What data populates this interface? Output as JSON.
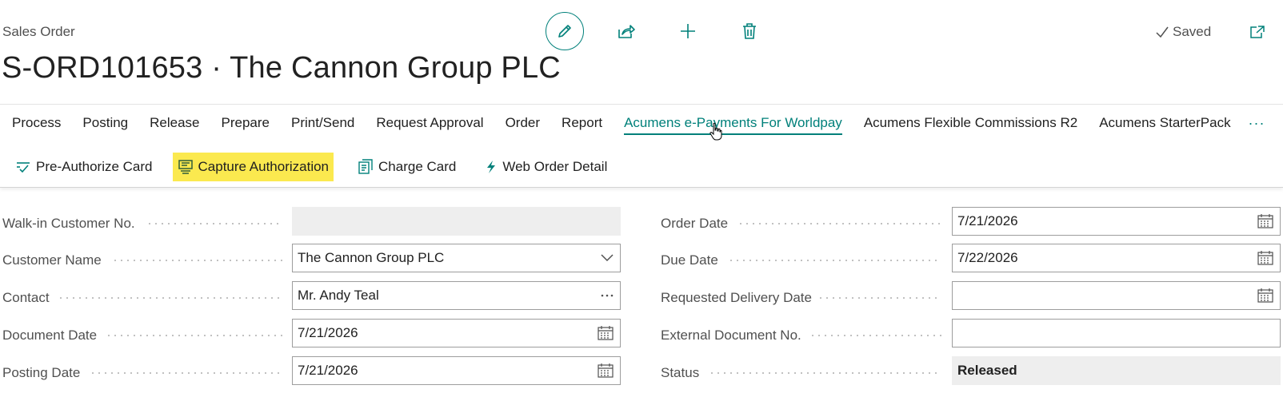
{
  "header": {
    "caption": "Sales Order",
    "title": "S-ORD101653 · The Cannon Group PLC",
    "saved_label": "Saved"
  },
  "top_actions": [
    {
      "icon": "pencil-icon"
    },
    {
      "icon": "share-icon"
    },
    {
      "icon": "plus-icon"
    },
    {
      "icon": "trash-icon"
    }
  ],
  "menu": {
    "items": [
      "Process",
      "Posting",
      "Release",
      "Prepare",
      "Print/Send",
      "Request Approval",
      "Order",
      "Report",
      "Acumens e-Payments For Worldpay",
      "Acumens Flexible Commissions R2",
      "Acumens StarterPack"
    ],
    "active": "Acumens e-Payments For Worldpay",
    "more_label": "···"
  },
  "actions": [
    {
      "label": "Pre-Authorize Card",
      "icon": "preauthorize-icon"
    },
    {
      "label": "Capture Authorization",
      "icon": "capture-icon",
      "highlighted": true
    },
    {
      "label": "Charge Card",
      "icon": "charge-card-icon"
    },
    {
      "label": "Web Order Detail",
      "icon": "lightning-icon"
    }
  ],
  "form": {
    "left": [
      {
        "label": "Walk-in Customer No.",
        "value": "",
        "kind": "readonly"
      },
      {
        "label": "Customer Name",
        "value": "The Cannon Group PLC",
        "kind": "dropdown"
      },
      {
        "label": "Contact",
        "value": "Mr. Andy Teal",
        "kind": "lookup"
      },
      {
        "label": "Document Date",
        "value": "7/21/2026",
        "kind": "date"
      },
      {
        "label": "Posting Date",
        "value": "7/21/2026",
        "kind": "date"
      }
    ],
    "right": [
      {
        "label": "Order Date",
        "value": "7/21/2026",
        "kind": "date"
      },
      {
        "label": "Due Date",
        "value": "7/22/2026",
        "kind": "date"
      },
      {
        "label": "Requested Delivery Date",
        "value": "",
        "kind": "date"
      },
      {
        "label": "External Document No.",
        "value": "",
        "kind": "text"
      },
      {
        "label": "Status",
        "value": "Released",
        "kind": "status"
      }
    ]
  },
  "colors": {
    "accent": "#00807a",
    "highlight": "#fbe94f",
    "readonly_bg": "#eeeeee"
  }
}
